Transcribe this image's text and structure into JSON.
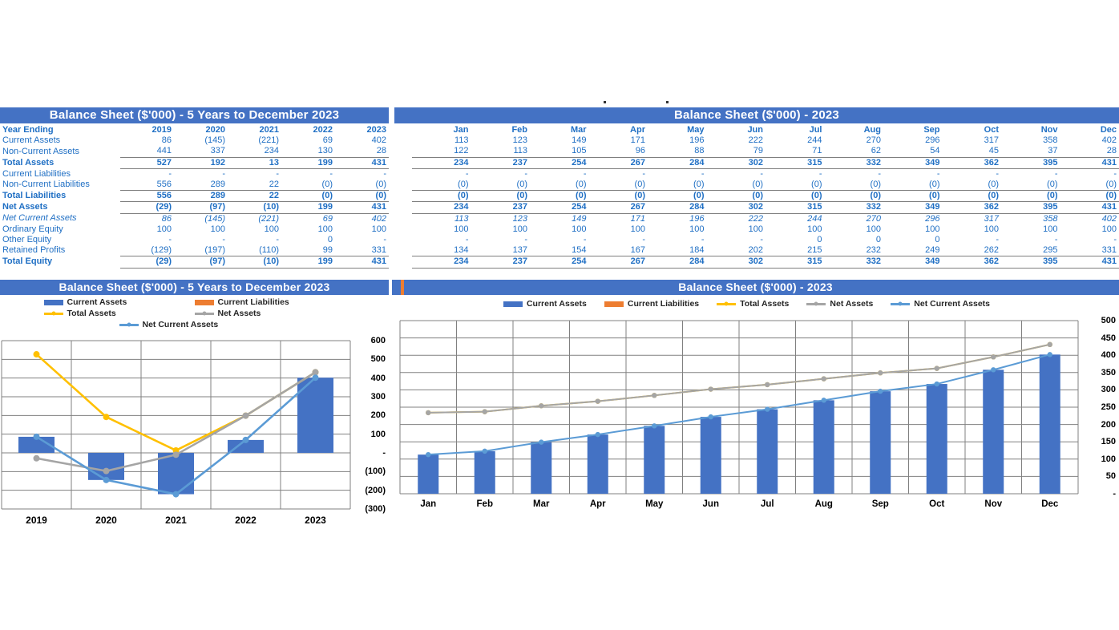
{
  "colors": {
    "header_blue": "#4472C4",
    "text_blue": "#1F6FC4",
    "bar_blue": "#4472C4",
    "line_orange": "#ED7D31",
    "line_yellow": "#FFC000",
    "line_gray": "#A5A5A5",
    "line_lightblue": "#5B9BD5"
  },
  "left_table": {
    "title": "Balance Sheet ($'000) - 5 Years to December 2023",
    "header_label": "Year Ending",
    "columns": [
      "2019",
      "2020",
      "2021",
      "2022",
      "2023"
    ],
    "rows": [
      {
        "label": "Current Assets",
        "style": "plain",
        "values": [
          "86",
          "(145)",
          "(221)",
          "69",
          "402"
        ]
      },
      {
        "label": "Non-Current Assets",
        "style": "plain",
        "values": [
          "441",
          "337",
          "234",
          "130",
          "28"
        ]
      },
      {
        "label": "Total Assets",
        "style": "bold",
        "values": [
          "527",
          "192",
          "13",
          "199",
          "431"
        ]
      },
      {
        "label": "Current Liabilities",
        "style": "plain",
        "values": [
          "-",
          "-",
          "-",
          "-",
          "-"
        ]
      },
      {
        "label": "Non-Current Liabilities",
        "style": "plain",
        "values": [
          "556",
          "289",
          "22",
          "(0)",
          "(0)"
        ]
      },
      {
        "label": "Total Liabilities",
        "style": "bold",
        "values": [
          "556",
          "289",
          "22",
          "(0)",
          "(0)"
        ]
      },
      {
        "label": "Net Assets",
        "style": "bold",
        "values": [
          "(29)",
          "(97)",
          "(10)",
          "199",
          "431"
        ]
      },
      {
        "label": "Net Current Assets",
        "style": "italic",
        "values": [
          "86",
          "(145)",
          "(221)",
          "69",
          "402"
        ]
      },
      {
        "label": "Ordinary Equity",
        "style": "plain",
        "values": [
          "100",
          "100",
          "100",
          "100",
          "100"
        ]
      },
      {
        "label": "Other Equity",
        "style": "plain",
        "values": [
          "-",
          "-",
          "-",
          "0",
          "-"
        ]
      },
      {
        "label": "Retained Profits",
        "style": "plain",
        "values": [
          "(129)",
          "(197)",
          "(110)",
          "99",
          "331"
        ]
      },
      {
        "label": "Total Equity",
        "style": "bold",
        "values": [
          "(29)",
          "(97)",
          "(10)",
          "199",
          "431"
        ]
      }
    ]
  },
  "right_table": {
    "title": "Balance Sheet ($'000) - 2023",
    "columns": [
      "Jan",
      "Feb",
      "Mar",
      "Apr",
      "May",
      "Jun",
      "Jul",
      "Aug",
      "Sep",
      "Oct",
      "Nov",
      "Dec"
    ],
    "rows": [
      {
        "label": "",
        "style": "plain",
        "values": [
          "113",
          "123",
          "149",
          "171",
          "196",
          "222",
          "244",
          "270",
          "296",
          "317",
          "358",
          "402"
        ]
      },
      {
        "label": "",
        "style": "plain",
        "values": [
          "122",
          "113",
          "105",
          "96",
          "88",
          "79",
          "71",
          "62",
          "54",
          "45",
          "37",
          "28"
        ]
      },
      {
        "label": "",
        "style": "bold",
        "values": [
          "234",
          "237",
          "254",
          "267",
          "284",
          "302",
          "315",
          "332",
          "349",
          "362",
          "395",
          "431"
        ]
      },
      {
        "label": "",
        "style": "plain",
        "values": [
          "-",
          "-",
          "-",
          "-",
          "-",
          "-",
          "-",
          "-",
          "-",
          "-",
          "-",
          "-"
        ]
      },
      {
        "label": "",
        "style": "plain",
        "values": [
          "(0)",
          "(0)",
          "(0)",
          "(0)",
          "(0)",
          "(0)",
          "(0)",
          "(0)",
          "(0)",
          "(0)",
          "(0)",
          "(0)"
        ]
      },
      {
        "label": "",
        "style": "bold",
        "values": [
          "(0)",
          "(0)",
          "(0)",
          "(0)",
          "(0)",
          "(0)",
          "(0)",
          "(0)",
          "(0)",
          "(0)",
          "(0)",
          "(0)"
        ]
      },
      {
        "label": "",
        "style": "bold",
        "values": [
          "234",
          "237",
          "254",
          "267",
          "284",
          "302",
          "315",
          "332",
          "349",
          "362",
          "395",
          "431"
        ]
      },
      {
        "label": "",
        "style": "italic",
        "values": [
          "113",
          "123",
          "149",
          "171",
          "196",
          "222",
          "244",
          "270",
          "296",
          "317",
          "358",
          "402"
        ]
      },
      {
        "label": "",
        "style": "plain",
        "values": [
          "100",
          "100",
          "100",
          "100",
          "100",
          "100",
          "100",
          "100",
          "100",
          "100",
          "100",
          "100"
        ]
      },
      {
        "label": "",
        "style": "plain",
        "values": [
          "-",
          "-",
          "-",
          "-",
          "-",
          "-",
          "0",
          "0",
          "0",
          "-",
          "-",
          "-"
        ]
      },
      {
        "label": "",
        "style": "plain",
        "values": [
          "134",
          "137",
          "154",
          "167",
          "184",
          "202",
          "215",
          "232",
          "249",
          "262",
          "295",
          "331"
        ]
      },
      {
        "label": "",
        "style": "bold",
        "values": [
          "234",
          "237",
          "254",
          "267",
          "284",
          "302",
          "315",
          "332",
          "349",
          "362",
          "395",
          "431"
        ]
      }
    ]
  },
  "chart_data": [
    {
      "id": "left-chart",
      "type": "bar",
      "title": "Balance Sheet ($'000) - 5 Years to December 2023",
      "categories": [
        "2019",
        "2020",
        "2021",
        "2022",
        "2023"
      ],
      "xlabel": "",
      "ylabel": "",
      "ylim": [
        -300,
        600
      ],
      "ytick_labels": [
        "600",
        "500",
        "400",
        "300",
        "200",
        "100",
        "-",
        "(100)",
        "(200)",
        "(300)"
      ],
      "ytick_values": [
        600,
        500,
        400,
        300,
        200,
        100,
        0,
        -100,
        -200,
        -300
      ],
      "grid": true,
      "legend_position": "top",
      "series": [
        {
          "name": "Current Assets",
          "kind": "bar",
          "color": "#4472C4",
          "values": [
            86,
            -145,
            -221,
            69,
            402
          ]
        },
        {
          "name": "Current Liabilities",
          "kind": "bar",
          "color": "#ED7D31",
          "values": [
            0,
            0,
            0,
            0,
            0
          ]
        },
        {
          "name": "Total Assets",
          "kind": "line",
          "color": "#FFC000",
          "values": [
            527,
            192,
            13,
            199,
            431
          ]
        },
        {
          "name": "Net Assets",
          "kind": "line",
          "color": "#A5A5A5",
          "values": [
            -29,
            -97,
            -10,
            199,
            431
          ]
        },
        {
          "name": "Net Current Assets",
          "kind": "line",
          "color": "#5B9BD5",
          "values": [
            86,
            -145,
            -221,
            69,
            402
          ]
        }
      ]
    },
    {
      "id": "right-chart",
      "type": "bar",
      "title": "Balance Sheet ($'000) - 2023",
      "categories": [
        "Jan",
        "Feb",
        "Mar",
        "Apr",
        "May",
        "Jun",
        "Jul",
        "Aug",
        "Sep",
        "Oct",
        "Nov",
        "Dec"
      ],
      "xlabel": "",
      "ylabel": "",
      "ylim": [
        0,
        500
      ],
      "ytick_labels": [
        "500",
        "450",
        "400",
        "350",
        "300",
        "250",
        "200",
        "150",
        "100",
        "50",
        "-"
      ],
      "ytick_values": [
        500,
        450,
        400,
        350,
        300,
        250,
        200,
        150,
        100,
        50,
        0
      ],
      "grid": true,
      "legend_position": "top",
      "series": [
        {
          "name": "Current Assets",
          "kind": "bar",
          "color": "#4472C4",
          "values": [
            113,
            123,
            149,
            171,
            196,
            222,
            244,
            270,
            296,
            317,
            358,
            402
          ]
        },
        {
          "name": "Current Liabilities",
          "kind": "bar",
          "color": "#ED7D31",
          "values": [
            0,
            0,
            0,
            0,
            0,
            0,
            0,
            0,
            0,
            0,
            0,
            0
          ]
        },
        {
          "name": "Total Assets",
          "kind": "line",
          "color": "#FFC000",
          "values": [
            234,
            237,
            254,
            267,
            284,
            302,
            315,
            332,
            349,
            362,
            395,
            431
          ]
        },
        {
          "name": "Net Assets",
          "kind": "line",
          "color": "#A5A5A5",
          "values": [
            234,
            237,
            254,
            267,
            284,
            302,
            315,
            332,
            349,
            362,
            395,
            431
          ]
        },
        {
          "name": "Net Current Assets",
          "kind": "line",
          "color": "#5B9BD5",
          "values": [
            113,
            123,
            149,
            171,
            196,
            222,
            244,
            270,
            296,
            317,
            358,
            402
          ]
        }
      ]
    }
  ]
}
